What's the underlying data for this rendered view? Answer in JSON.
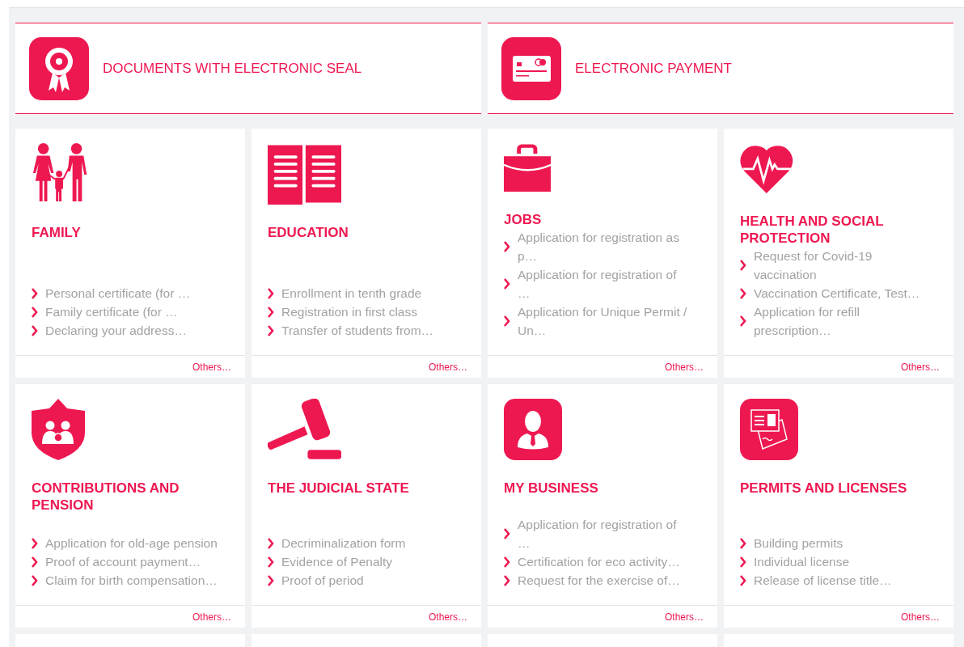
{
  "features": [
    {
      "kind": "seal",
      "title": "DOCUMENTS WITH ELECTRONIC SEAL"
    },
    {
      "kind": "card",
      "title": "ELECTRONIC PAYMENT"
    }
  ],
  "categories": [
    {
      "kind": "family",
      "title": "FAMILY",
      "links": [
        "Personal certificate (for …",
        "Family certificate (for …",
        "Declaring your address…"
      ],
      "more": "Others…"
    },
    {
      "kind": "book",
      "title": "EDUCATION",
      "links": [
        "Enrollment in tenth grade",
        "Registration in first class",
        "Transfer of students from…"
      ],
      "more": "Others…"
    },
    {
      "kind": "briefcase",
      "title": "JOBS",
      "links": [
        "Application for registration as p…",
        "Application for registration of …",
        "Application for Unique Permit / Un…"
      ],
      "more": "Others…"
    },
    {
      "kind": "heart",
      "title": "HEALTH AND SOCIAL PROTECTION",
      "links": [
        "Request for Covid-19 vaccination",
        "Vaccination Certificate, Test…",
        "Application for refill prescription…"
      ],
      "more": "Others…"
    },
    {
      "kind": "shield",
      "title": "CONTRIBUTIONS AND PENSION",
      "links": [
        "Application for old-age pension",
        "Proof of account payment…",
        "Claim for birth compensation…"
      ],
      "more": "Others…"
    },
    {
      "kind": "gavel",
      "title": "THE JUDICIAL STATE",
      "links": [
        "Decriminalization form",
        "Evidence of Penalty",
        "Proof of period"
      ],
      "more": "Others…"
    },
    {
      "kind": "person",
      "title": "MY BUSINESS",
      "links": [
        "Application for registration of …",
        "Certification for eco activity…",
        "Request for the exercise of…"
      ],
      "more": "Others…"
    },
    {
      "kind": "permit",
      "title": "PERMITS AND LICENSES",
      "links": [
        "Building permits",
        "Individual license",
        "Release of license title…"
      ],
      "more": "Others…"
    }
  ]
}
